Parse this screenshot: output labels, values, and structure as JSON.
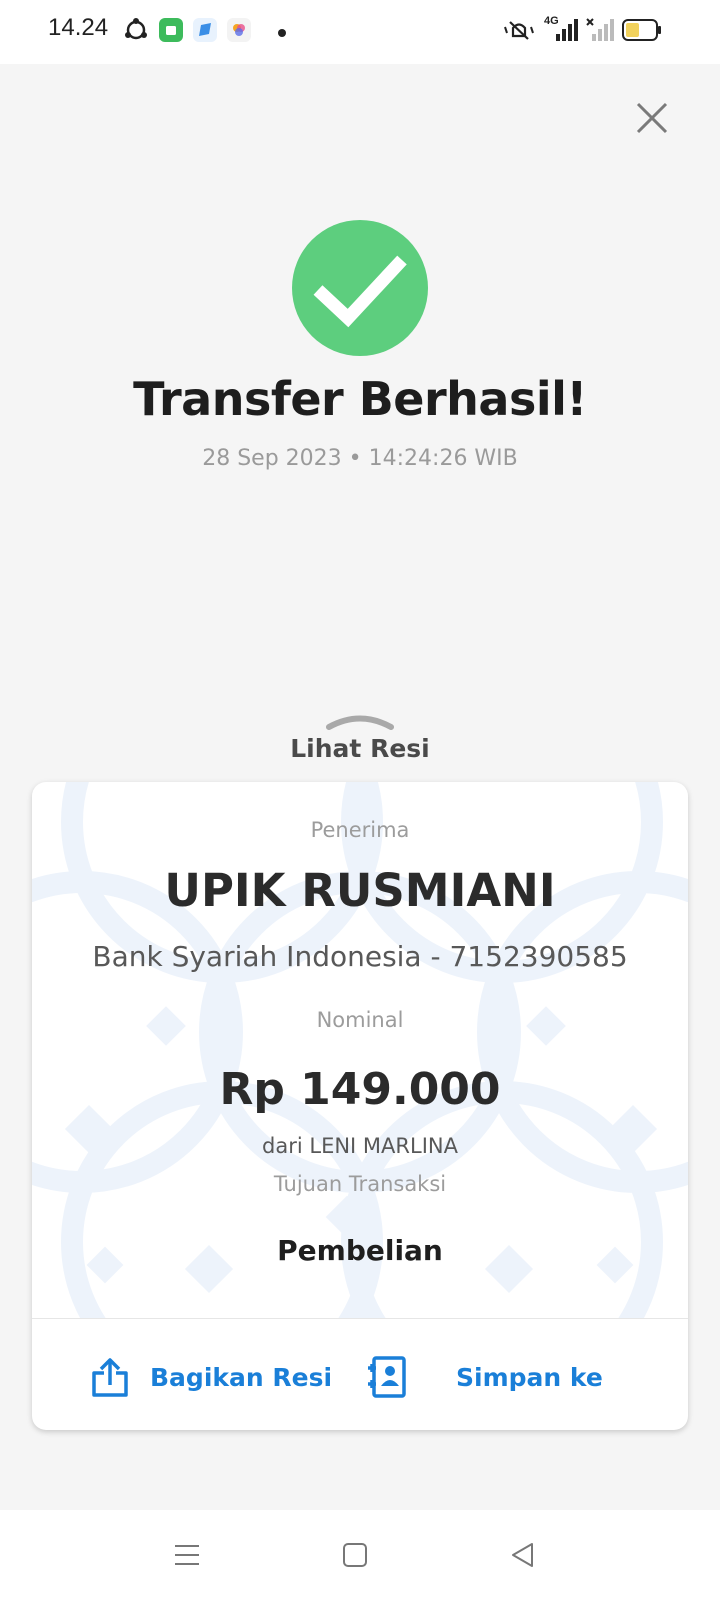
{
  "status_bar": {
    "time": "14.24",
    "left_icons": [
      "sync-icon",
      "app-store-icon",
      "bubble-app-icon",
      "photos-icon",
      "notification-dot-icon"
    ],
    "right_icons": [
      "mute-icon",
      "signal-4g-icon",
      "signal-no-sim-icon",
      "battery-icon"
    ],
    "network_label": "4G"
  },
  "header": {
    "close_icon": "close-icon"
  },
  "success": {
    "icon": "check-icon",
    "color": "#5dce7e",
    "title": "Transfer Berhasil!",
    "timestamp": "28 Sep 2023 • 14:24:26 WIB"
  },
  "receipt_toggle": {
    "label": "Lihat Resi",
    "icon": "chevron-up-icon"
  },
  "receipt": {
    "recipient_label": "Penerima",
    "recipient_name": "UPIK RUSMIANI",
    "recipient_bank": "Bank Syariah Indonesia - 7152390585",
    "amount_label": "Nominal",
    "amount": "Rp 149.000",
    "from": "dari LENI MARLINA",
    "purpose_label": "Tujuan Transaksi",
    "purpose": "Pembelian"
  },
  "actions": {
    "share_label": "Bagikan Resi",
    "share_icon": "share-icon",
    "save_label": "Simpan ke",
    "save_icon": "save-contact-icon",
    "accent_color": "#1a7fd8"
  },
  "nav_bar": {
    "icons": [
      "menu-icon",
      "home-icon",
      "back-icon"
    ]
  }
}
